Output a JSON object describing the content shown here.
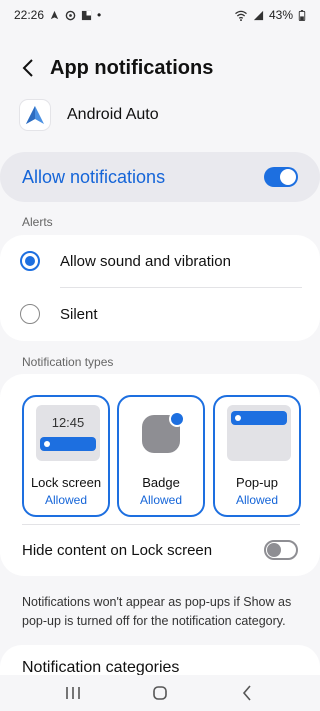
{
  "status_bar": {
    "time": "22:26",
    "battery": "43%"
  },
  "header": {
    "title": "App notifications"
  },
  "app": {
    "name": "Android Auto"
  },
  "allow": {
    "label": "Allow notifications",
    "enabled": true
  },
  "alerts": {
    "section_label": "Alerts",
    "options": [
      {
        "label": "Allow sound and vibration",
        "selected": true
      },
      {
        "label": "Silent",
        "selected": false
      }
    ]
  },
  "types": {
    "section_label": "Notification types",
    "items": [
      {
        "name": "Lock screen",
        "status": "Allowed",
        "preview_time": "12:45"
      },
      {
        "name": "Badge",
        "status": "Allowed"
      },
      {
        "name": "Pop-up",
        "status": "Allowed"
      }
    ]
  },
  "hide_content": {
    "label": "Hide content on Lock screen",
    "enabled": false
  },
  "info": {
    "text": "Notifications won't appear as pop-ups if Show as pop-up is turned off for the notification category."
  },
  "categories": {
    "label": "Notification categories"
  },
  "colors": {
    "accent": "#1d6fe0",
    "accent_text": "#1565d8",
    "background": "#f6f6f8"
  }
}
